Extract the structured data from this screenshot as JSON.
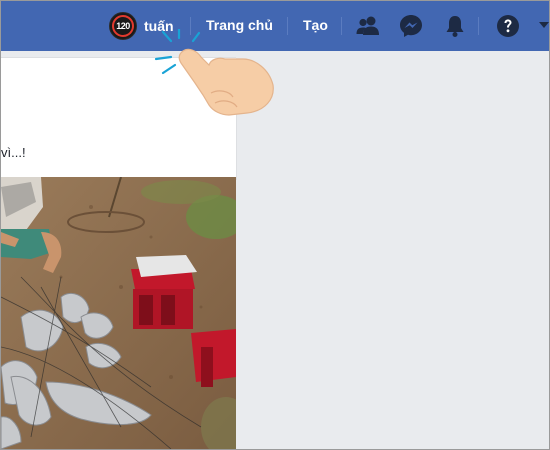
{
  "header": {
    "user_name": "tuấn",
    "avatar_text": "120",
    "nav": {
      "home_label": "Trang chủ",
      "create_label": "Tạo"
    },
    "icons": [
      "friends-icon",
      "messenger-icon",
      "notifications-icon",
      "help-icon",
      "dropdown-arrow-icon"
    ]
  },
  "post": {
    "text": "vì...!"
  },
  "colors": {
    "brand_blue": "#4267b2",
    "page_bg": "#e9ebee",
    "card_bg": "#ffffff"
  }
}
